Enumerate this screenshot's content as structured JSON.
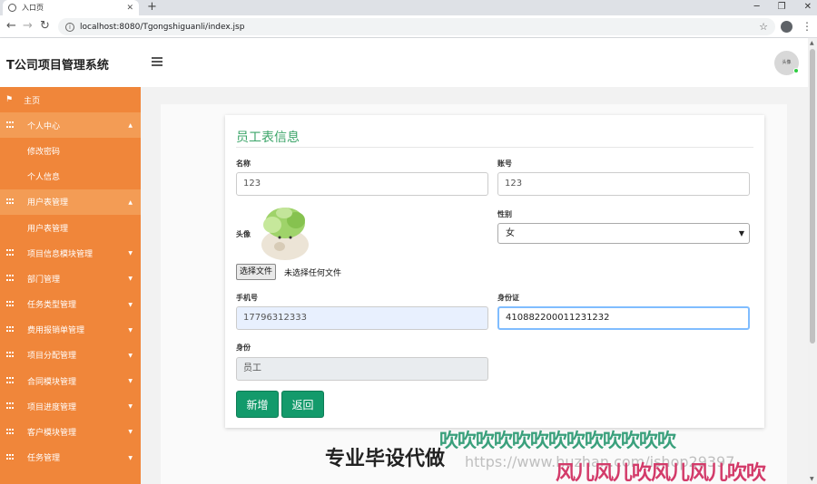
{
  "browser": {
    "tab_title": "入口页",
    "new_tab": "+",
    "url": "localhost:8080/Tgongshiguanli/index.jsp"
  },
  "header": {
    "brand": "T公司项目管理系统",
    "avatar_text": "头像"
  },
  "sidebar": {
    "items": [
      {
        "label": "主页"
      },
      {
        "label": "个人中心"
      },
      {
        "label": "修改密码"
      },
      {
        "label": "个人信息"
      },
      {
        "label": "用户表管理"
      },
      {
        "label": "用户表管理"
      },
      {
        "label": "项目信息模块管理"
      },
      {
        "label": "部门管理"
      },
      {
        "label": "任务类型管理"
      },
      {
        "label": "费用报销单管理"
      },
      {
        "label": "项目分配管理"
      },
      {
        "label": "合同模块管理"
      },
      {
        "label": "项目进度管理"
      },
      {
        "label": "客户模块管理"
      },
      {
        "label": "任务管理"
      }
    ]
  },
  "form": {
    "title": "员工表信息",
    "name_label": "名称",
    "name_value": "123",
    "account_label": "账号",
    "account_value": "123",
    "avatar_label": "头像",
    "file_button": "选择文件",
    "file_status": "未选择任何文件",
    "gender_label": "性别",
    "gender_value": "女",
    "phone_label": "手机号",
    "phone_value": "17796312333",
    "idcard_label": "身份证",
    "idcard_value": "410882200011231232",
    "role_label": "身份",
    "role_value": "员工",
    "add_button": "新增",
    "back_button": "返回"
  },
  "watermarks": {
    "line1": "吹吹吹吹吹吹吹吹吹吹吹吹吹",
    "line2": "专业毕设代做",
    "line3": "https://www.huzhan.com/ishop29397",
    "line4": "风儿风儿吹风儿风儿吹吹"
  }
}
